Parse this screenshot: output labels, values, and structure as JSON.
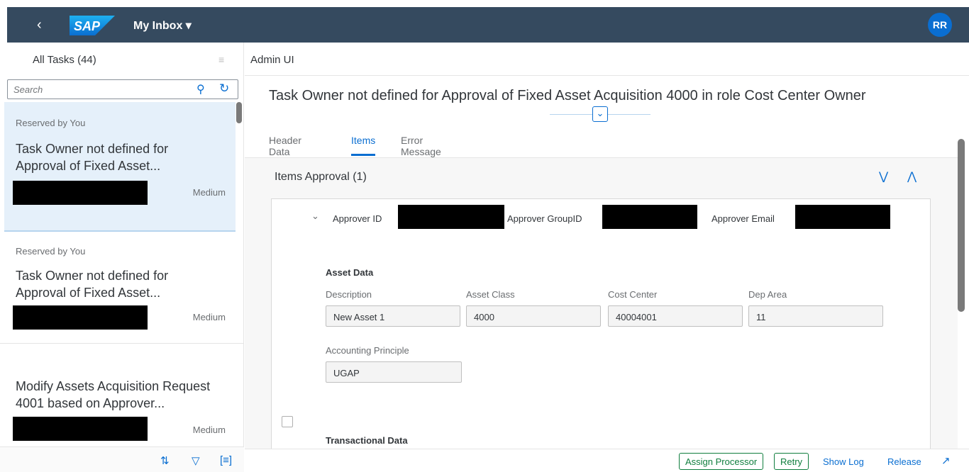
{
  "shell": {
    "back_icon": "chevron-left-icon",
    "logo_text": "SAP",
    "title": "My Inbox ▾",
    "avatar_initials": "RR"
  },
  "master": {
    "title": "All Tasks (44)",
    "search_placeholder": "Search",
    "items": [
      {
        "status": "Reserved by You",
        "name_line1": "Task Owner not defined for",
        "name_line2": "Approval of Fixed Asset...",
        "priority": "Medium"
      },
      {
        "status": "Reserved by You",
        "name_line1": "Task Owner not defined for",
        "name_line2": "Approval of Fixed Asset...",
        "priority": "Medium"
      },
      {
        "status": "",
        "name_line1": "Modify Assets Acquisition Request",
        "name_line2": "4001 based on Approver...",
        "priority": "Medium"
      }
    ]
  },
  "detail": {
    "breadcrumb": "Admin UI",
    "title": "Task Owner not defined for Approval of Fixed Asset Acquisition 4000 in role Cost Center Owner",
    "tabs": [
      {
        "label": "Header Data"
      },
      {
        "label": "Items"
      },
      {
        "label": "Error Message"
      }
    ],
    "section_title": "Items Approval (1)",
    "panel": {
      "approver_id_label": "Approver ID",
      "approver_group_label": "Approver GroupID",
      "approver_email_label": "Approver Email",
      "asset_data_label": "Asset Data",
      "fields": {
        "description_label": "Description",
        "description_value": "New Asset 1",
        "asset_class_label": "Asset Class",
        "asset_class_value": "4000",
        "cost_center_label": "Cost Center",
        "cost_center_value": "40004001",
        "dep_area_label": "Dep Area",
        "dep_area_value": "11",
        "accounting_label": "Accounting Principle",
        "accounting_value": "UGAP"
      },
      "transactional_label": "Transactional Data"
    },
    "footer": {
      "assign": "Assign Processor",
      "retry": "Retry",
      "show_log": "Show Log",
      "release": "Release"
    }
  },
  "colors": {
    "shell_bg": "#354a5f",
    "accent": "#0a6ed1",
    "selected_bg": "#e5f0fa",
    "positive": "#107e3e"
  }
}
